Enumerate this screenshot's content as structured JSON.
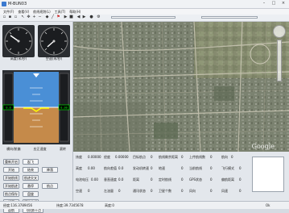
{
  "window": {
    "title": "M-BUN03"
  },
  "menu": [
    "文件(F)",
    "查看(V)",
    "航线规划(L)",
    "工具(T)",
    "帮助(H)"
  ],
  "gauges": [
    {
      "label": "高度(米/秒)"
    },
    {
      "label": "空速(米/秒)"
    }
  ],
  "attitude": {
    "left_scale_top": "0.0",
    "right_scale_top": "0.00",
    "labels": [
      "横向/航偏",
      "应正速度",
      "滚转"
    ]
  },
  "buttons": [
    [
      "重新开启",
      "起飞"
    ],
    [
      "开始",
      "结束",
      "降落"
    ],
    [
      "开始航线",
      "航迹交叉"
    ],
    [
      "开始航迹",
      "悬停",
      "航点"
    ],
    [
      "航点保存",
      "盘旋"
    ],
    [
      "设置",
      "清除航线"
    ],
    [
      "返航",
      "飞机第十点"
    ]
  ],
  "params": {
    "rows": [
      [
        "纬度",
        "0.00000",
        "经度",
        "0.00000",
        "目标航点",
        "0",
        "航线剩余距离",
        "0",
        "上传航线数",
        "0",
        "航向",
        "0"
      ],
      [
        "高度",
        "0.00",
        "航向差值",
        "0.0",
        "发动机转速",
        "0",
        "地速",
        "0",
        "当前航线",
        "0",
        "飞行模式",
        "0"
      ],
      [
        "电池电压",
        "0.00",
        "垂直速度",
        "0.0",
        "距离",
        "0",
        "定时航线",
        "0",
        "GPS状态",
        "0",
        "偏航距离",
        "0"
      ],
      [
        "空速",
        "0",
        "左油量",
        "0",
        "通讯状态",
        "0",
        "卫星个数",
        "0",
        "风向",
        "0",
        "风速",
        "0"
      ]
    ]
  },
  "status": {
    "lon": "经度:116.3789456",
    "lat": "纬度:39.7345678",
    "alt": "高度:0",
    "extra": "Ok"
  },
  "map": {
    "credit": "Google"
  }
}
